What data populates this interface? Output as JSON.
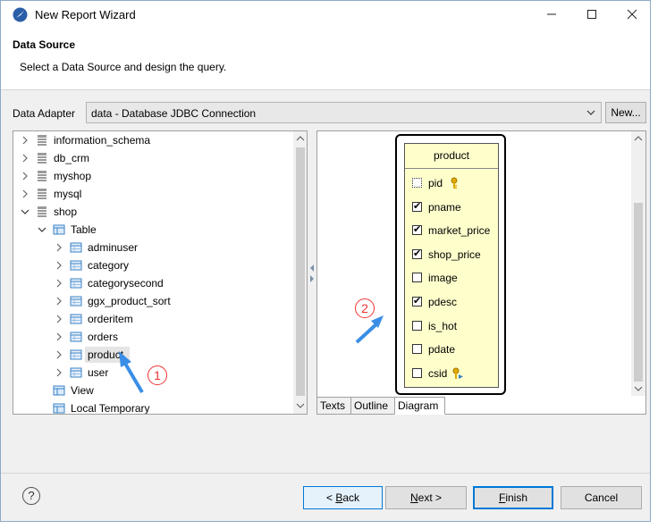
{
  "window": {
    "title": "New Report Wizard"
  },
  "header": {
    "title": "Data Source",
    "description": "Select a Data Source and design the query."
  },
  "adapter": {
    "label": "Data Adapter",
    "value": "data - Database JDBC Connection",
    "new_label": "New..."
  },
  "tree": {
    "items": [
      {
        "label": "information_schema"
      },
      {
        "label": "db_crm"
      },
      {
        "label": "myshop"
      },
      {
        "label": "mysql"
      },
      {
        "label": "shop"
      },
      {
        "label": "Table"
      },
      {
        "label": "adminuser"
      },
      {
        "label": "category"
      },
      {
        "label": "categorysecond"
      },
      {
        "label": "ggx_product_sort"
      },
      {
        "label": "orderitem"
      },
      {
        "label": "orders"
      },
      {
        "label": "product"
      },
      {
        "label": "user"
      },
      {
        "label": "View"
      },
      {
        "label": "Local Temporary"
      }
    ]
  },
  "diagram": {
    "table_name": "product",
    "fields": [
      {
        "name": "pid",
        "checked": false
      },
      {
        "name": "pname",
        "checked": true
      },
      {
        "name": "market_price",
        "checked": true
      },
      {
        "name": "shop_price",
        "checked": true
      },
      {
        "name": "image",
        "checked": false
      },
      {
        "name": "pdesc",
        "checked": true
      },
      {
        "name": "is_hot",
        "checked": false
      },
      {
        "name": "pdate",
        "checked": false
      },
      {
        "name": "csid",
        "checked": false
      }
    ]
  },
  "tabs": [
    {
      "label": "Texts"
    },
    {
      "label": "Outline"
    },
    {
      "label": "Diagram"
    }
  ],
  "annotations": {
    "one": "1",
    "two": "2"
  },
  "buttons": {
    "help": "?",
    "back": "< Back",
    "next": "Next >",
    "finish": "Finish",
    "cancel": "Cancel"
  },
  "colors": {
    "accent": "#0078d7",
    "annotation": "#e33333",
    "entity_fill": "#ffffcc",
    "arrow": "#3a8ee6"
  }
}
